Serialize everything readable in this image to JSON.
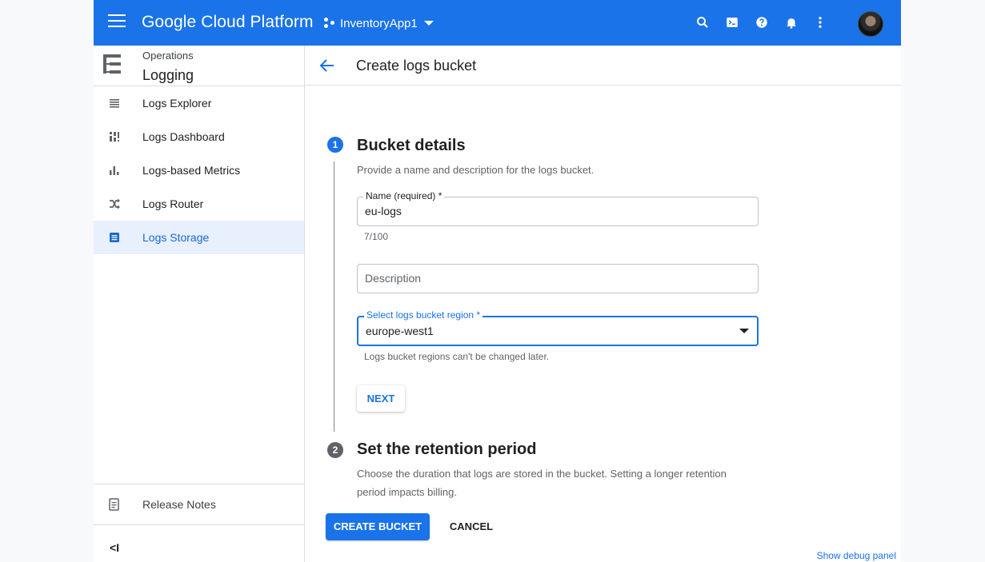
{
  "topbar": {
    "brand": "Google Cloud Platform",
    "project": "InventoryApp1",
    "icons": [
      "menu-icon",
      "search-icon",
      "cloud-shell-icon",
      "help-icon",
      "notifications-icon",
      "more-vert-icon"
    ],
    "accent_color": "#1a73e8"
  },
  "sidebar": {
    "product_sup": "Operations",
    "product_title": "Logging",
    "items": [
      {
        "label": "Logs Explorer",
        "icon": "list-icon"
      },
      {
        "label": "Logs Dashboard",
        "icon": "dashboard-icon"
      },
      {
        "label": "Logs-based Metrics",
        "icon": "bar-chart-icon"
      },
      {
        "label": "Logs Router",
        "icon": "router-icon"
      },
      {
        "label": "Logs Storage",
        "icon": "storage-icon",
        "active": true
      }
    ],
    "release_notes": "Release Notes",
    "collapse_label": "<I"
  },
  "page": {
    "title": "Create logs bucket"
  },
  "step1": {
    "number": "1",
    "title": "Bucket details",
    "hint": "Provide a name and description for the logs bucket.",
    "name_label": "Name (required) *",
    "name_value": "eu-logs",
    "char_count": "7/100",
    "description_placeholder": "Description",
    "region_label": "Select logs bucket region *",
    "region_value": "europe-west1",
    "region_hint": "Logs bucket regions can't be changed later.",
    "next_label": "NEXT"
  },
  "step2": {
    "number": "2",
    "title": "Set the retention period",
    "hint_line1": "Choose the duration that logs are stored in the bucket. Setting a longer retention",
    "hint_line2": "period impacts billing."
  },
  "actions": {
    "create_label": "CREATE BUCKET",
    "cancel_label": "CANCEL"
  },
  "debug_link": "Show debug panel"
}
